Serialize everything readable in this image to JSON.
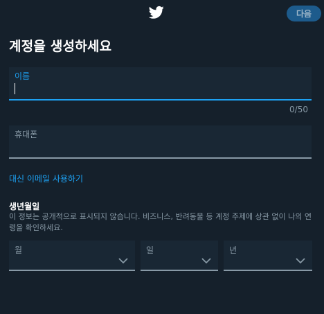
{
  "header": {
    "next_label": "다음",
    "logo_icon": "twitter-bird-icon"
  },
  "title": "계정을 생성하세요",
  "form": {
    "name": {
      "label": "이름",
      "value": "",
      "counter": "0/50"
    },
    "phone": {
      "label": "휴대폰",
      "value": ""
    },
    "email_link": "대신 이메일 사용하기",
    "dob": {
      "title": "생년월일",
      "description": "이 정보는 공개적으로 표시되지 않습니다. 비즈니스, 반려동물 등 계정 주제에 상관 없이 나의 연령을 확인하세요.",
      "month_label": "월",
      "day_label": "일",
      "year_label": "년"
    }
  },
  "colors": {
    "background": "#15202b",
    "accent": "#1da1f2",
    "field_bg": "#192734",
    "muted": "#8899a6"
  }
}
